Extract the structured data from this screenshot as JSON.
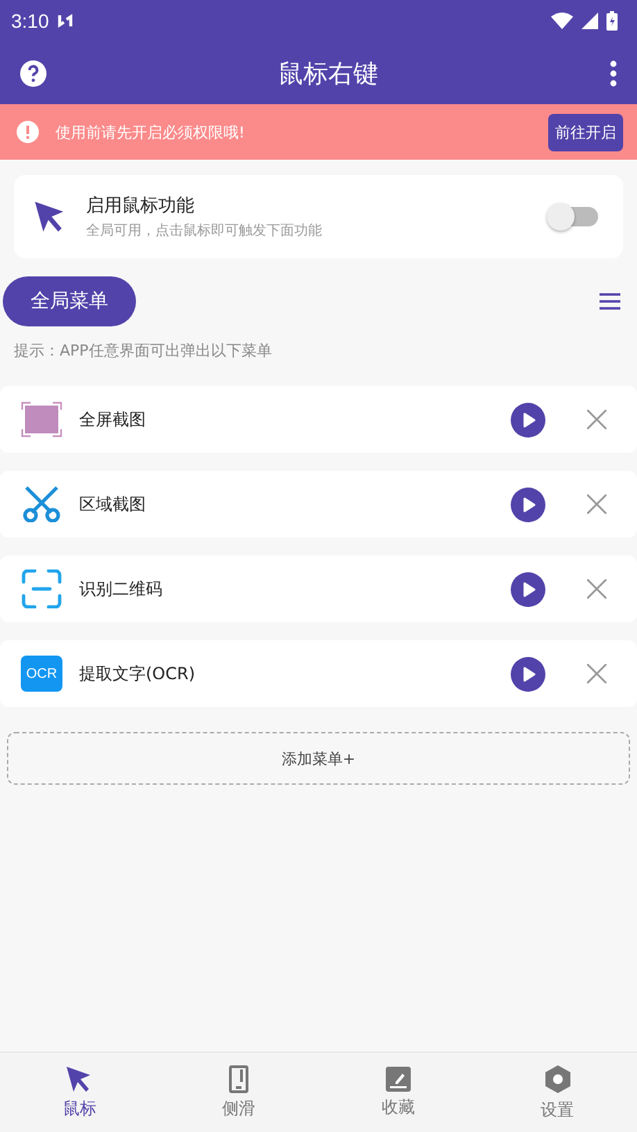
{
  "status_bar": {
    "time": "3:10"
  },
  "app_bar": {
    "title": "鼠标右键"
  },
  "banner": {
    "message": "使用前请先开启必须权限哦!",
    "action": "前往开启"
  },
  "enable_card": {
    "title": "启用鼠标功能",
    "subtitle": "全局可用，点击鼠标即可触发下面功能",
    "on": false
  },
  "menu_tab": {
    "label": "全局菜单"
  },
  "hint": "提示：APP任意界面可出弹出以下菜单",
  "menu_items": [
    {
      "kind": "fullscreen",
      "label": "全屏截图"
    },
    {
      "kind": "scissors",
      "label": "区域截图"
    },
    {
      "kind": "scan",
      "label": "识别二维码"
    },
    {
      "kind": "ocr",
      "badge": "OCR",
      "label": "提取文字(OCR)"
    }
  ],
  "add_button": "添加菜单+",
  "bottom_nav": [
    {
      "kind": "mouse",
      "label": "鼠标",
      "selected": true
    },
    {
      "kind": "phone",
      "label": "侧滑",
      "selected": false
    },
    {
      "kind": "note",
      "label": "收藏",
      "selected": false
    },
    {
      "kind": "settings",
      "label": "设置",
      "selected": false
    }
  ]
}
